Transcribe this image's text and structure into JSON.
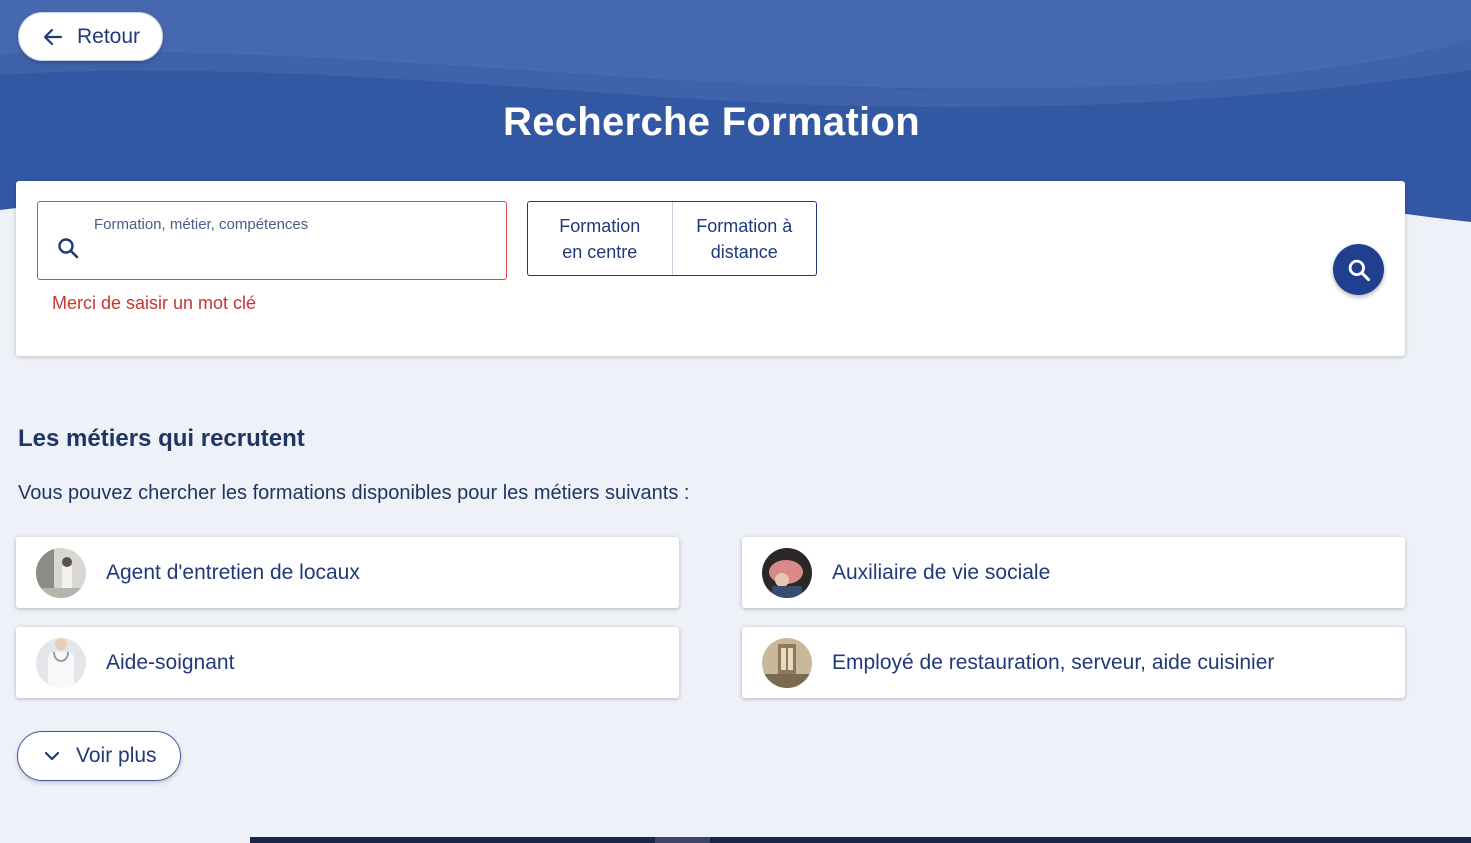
{
  "header": {
    "back_label": "Retour",
    "title": "Recherche Formation"
  },
  "search": {
    "placeholder": "Formation, métier, compétences",
    "value": "",
    "error": "Merci de saisir un mot clé",
    "modes": [
      {
        "label": "Formation\nen centre"
      },
      {
        "label": "Formation à\ndistance"
      }
    ]
  },
  "jobs_section": {
    "title": "Les métiers qui recrutent",
    "subtitle": "Vous pouvez chercher les formations disponibles pour les métiers suivants :",
    "items": [
      {
        "label": "Agent d'entretien de locaux"
      },
      {
        "label": "Auxiliaire de vie sociale"
      },
      {
        "label": "Aide-soignant"
      },
      {
        "label": "Employé de restauration, serveur, aide cuisinier"
      }
    ],
    "more_label": "Voir plus"
  },
  "colors": {
    "primary": "#203f8f",
    "hero_blue": "#3358a3",
    "error": "#c8362f",
    "background": "#eef1f7"
  },
  "icons": [
    "arrow-left-icon",
    "search-icon",
    "chevron-down-icon"
  ]
}
